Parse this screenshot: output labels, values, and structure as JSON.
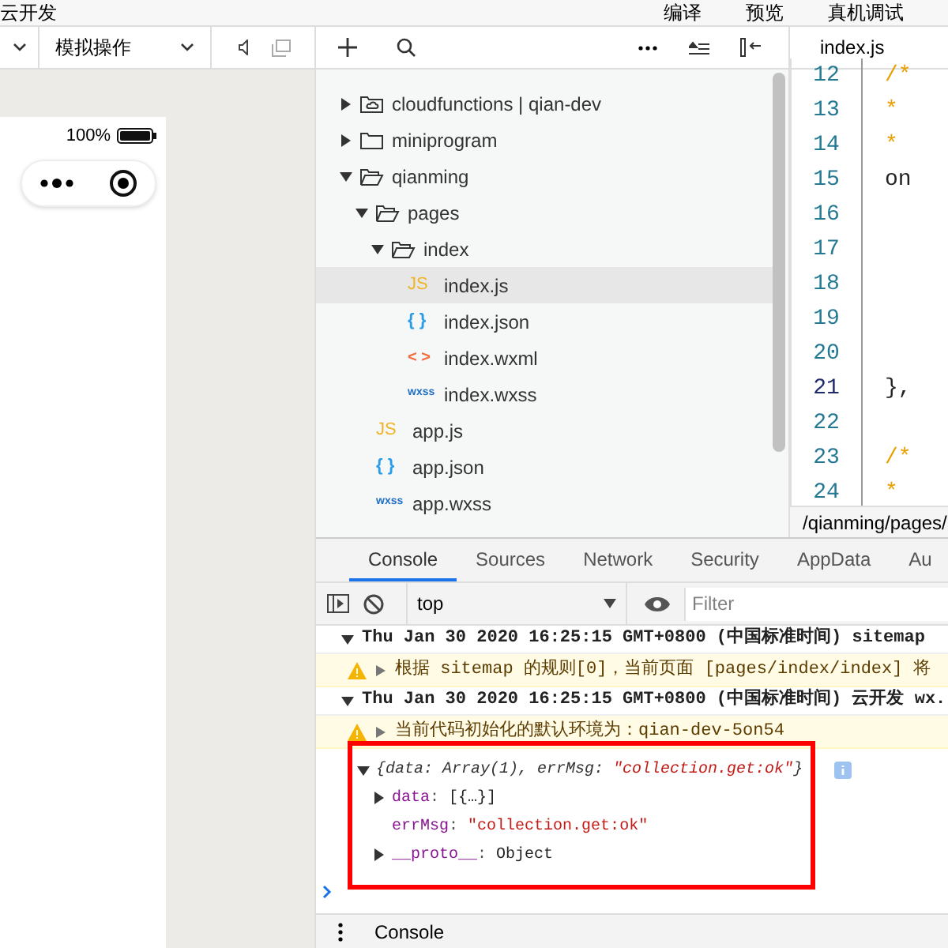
{
  "menu_bar": [
    "云开发",
    "编译",
    "预览",
    "真机调试"
  ],
  "simulator": {
    "mode_dropdown": "模拟操作",
    "battery_text": "100%"
  },
  "file_tree": [
    {
      "name": "cloudfunctions | qian-dev",
      "kind": "cloud-folder",
      "expanded": false,
      "selected": false
    },
    {
      "name": "miniprogram",
      "kind": "folder",
      "expanded": false,
      "selected": false
    },
    {
      "name": "qianming",
      "kind": "folder",
      "expanded": true,
      "selected": false,
      "children": [
        {
          "name": "pages",
          "kind": "folder",
          "expanded": true,
          "selected": false,
          "children": [
            {
              "name": "index",
              "kind": "folder",
              "expanded": true,
              "selected": false,
              "children": [
                {
                  "name": "index.js",
                  "kind": "js",
                  "icon": "JS",
                  "selected": true
                },
                {
                  "name": "index.json",
                  "kind": "json",
                  "icon": "{ }",
                  "selected": false
                },
                {
                  "name": "index.wxml",
                  "kind": "wxml",
                  "icon": "< >",
                  "selected": false
                },
                {
                  "name": "index.wxss",
                  "kind": "wxss",
                  "icon": "wxss",
                  "selected": false
                }
              ]
            }
          ]
        },
        {
          "name": "app.js",
          "kind": "js",
          "icon": "JS",
          "selected": false
        },
        {
          "name": "app.json",
          "kind": "json",
          "icon": "{ }",
          "selected": false
        },
        {
          "name": "app.wxss",
          "kind": "wxss",
          "icon": "wxss",
          "selected": false
        }
      ]
    }
  ],
  "editor": {
    "tab": "index.js",
    "lines": [
      {
        "number": "12",
        "code": "/*"
      },
      {
        "number": "13",
        "code": "*"
      },
      {
        "number": "14",
        "code": "*"
      },
      {
        "number": "15",
        "code": "on"
      },
      {
        "number": "16"
      },
      {
        "number": "17"
      },
      {
        "number": "18"
      },
      {
        "number": "19"
      },
      {
        "number": "20"
      },
      {
        "number": "21",
        "code": "},"
      },
      {
        "number": "22"
      },
      {
        "number": "23",
        "code": "/*"
      },
      {
        "number": "24",
        "code": "*"
      }
    ],
    "path": "/qianming/pages/"
  },
  "devtools": {
    "tabs": [
      {
        "label": "Console",
        "selected": true
      },
      {
        "label": "Sources",
        "selected": false
      },
      {
        "label": "Network",
        "selected": false
      },
      {
        "label": "Security",
        "selected": false
      },
      {
        "label": "AppData",
        "selected": false
      },
      {
        "label": "Au",
        "selected": false
      }
    ],
    "context": "top",
    "filter_placeholder": "Filter",
    "messages": [
      {
        "kind": "group",
        "text": "Thu Jan 30 2020 16:25:15 GMT+0800 (中国标准时间) sitemap"
      },
      {
        "kind": "warning",
        "text": "根据 sitemap 的规则[0]，当前页面 [pages/index/index] 将"
      },
      {
        "kind": "group",
        "text": "Thu Jan 30 2020 16:25:15 GMT+0800 (中国标准时间) 云开发 wx."
      },
      {
        "kind": "warning",
        "text": "当前代码初始化的默认环境为：qian-dev-5on54"
      }
    ],
    "object": {
      "summary_prefix": "{data: Array(1), errMsg: ",
      "summary_value": "\"collection.get:ok\"",
      "summary_suffix": "}",
      "separator": ":",
      "properties": [
        {
          "key": "data",
          "value": "[{…}]",
          "expandable": true
        },
        {
          "key": "errMsg",
          "value": "\"collection.get:ok\"",
          "expandable": false
        },
        {
          "key": "__proto__",
          "value": "Object",
          "expandable": true
        }
      ]
    },
    "drawer_tab": "Console"
  }
}
